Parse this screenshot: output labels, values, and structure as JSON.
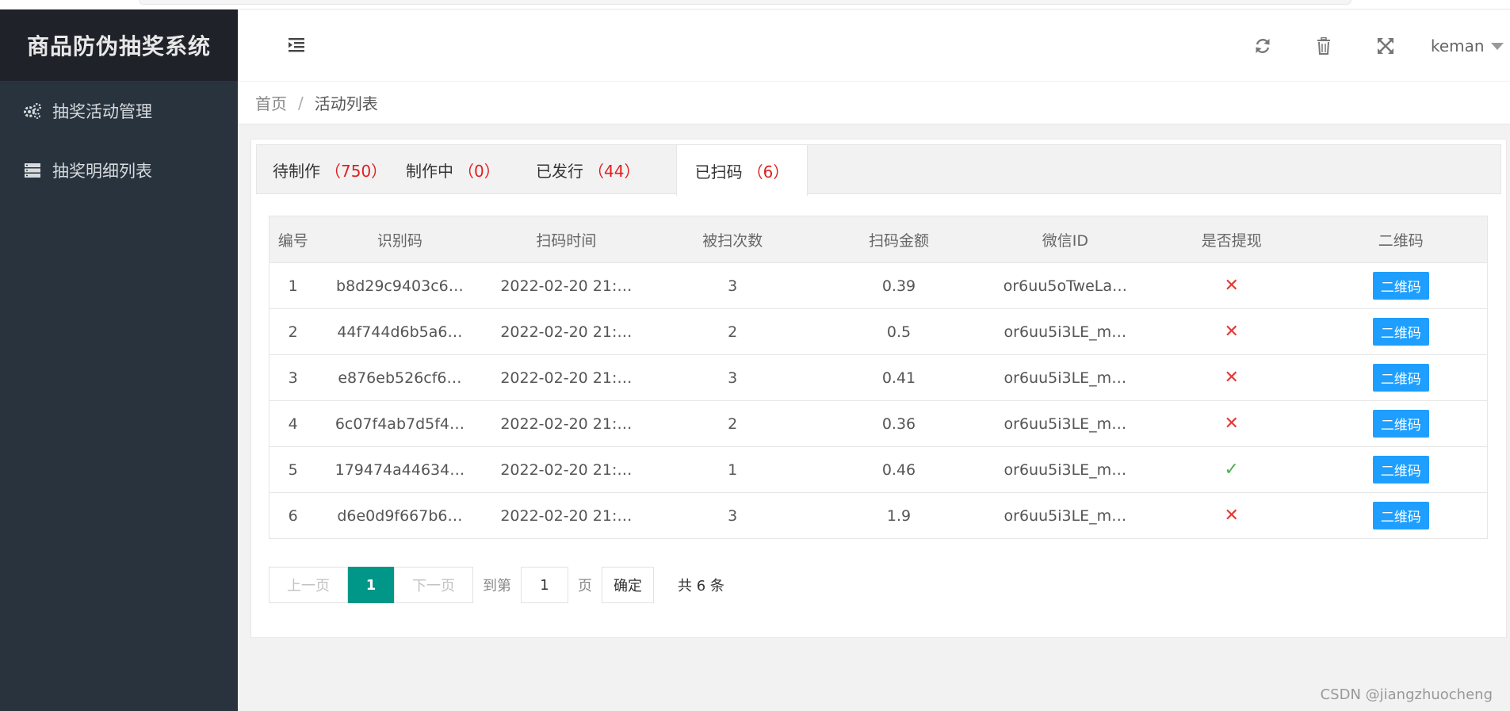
{
  "app": {
    "title": "商品防伪抽奖系统"
  },
  "sidebar": {
    "items": [
      {
        "label": "抽奖活动管理",
        "icon": "gears-icon"
      },
      {
        "label": "抽奖明细列表",
        "icon": "server-list-icon"
      }
    ]
  },
  "header": {
    "username": "keman"
  },
  "breadcrumb": {
    "home": "首页",
    "separator": "/",
    "current": "活动列表"
  },
  "tabs": [
    {
      "label": "待制作",
      "count": "（750）"
    },
    {
      "label": "制作中",
      "count": "（0）"
    },
    {
      "label": "已发行",
      "count": "（44）"
    },
    {
      "label": "已扫码",
      "count": "（6）"
    }
  ],
  "table": {
    "columns": [
      "编号",
      "识别码",
      "扫码时间",
      "被扫次数",
      "扫码金额",
      "微信ID",
      "是否提现",
      "二维码"
    ],
    "rows": [
      {
        "id": "1",
        "code": "b8d29c9403c6…",
        "time": "2022-02-20 21:…",
        "scans": "3",
        "amount": "0.39",
        "wechat": "or6uu5oTweLa…",
        "withdrawn": "✕",
        "qr": "二维码"
      },
      {
        "id": "2",
        "code": "44f744d6b5a6…",
        "time": "2022-02-20 21:…",
        "scans": "2",
        "amount": "0.5",
        "wechat": "or6uu5i3LE_m…",
        "withdrawn": "✕",
        "qr": "二维码"
      },
      {
        "id": "3",
        "code": "e876eb526cf6…",
        "time": "2022-02-20 21:…",
        "scans": "3",
        "amount": "0.41",
        "wechat": "or6uu5i3LE_m…",
        "withdrawn": "✕",
        "qr": "二维码"
      },
      {
        "id": "4",
        "code": "6c07f4ab7d5f4…",
        "time": "2022-02-20 21:…",
        "scans": "2",
        "amount": "0.36",
        "wechat": "or6uu5i3LE_m…",
        "withdrawn": "✕",
        "qr": "二维码"
      },
      {
        "id": "5",
        "code": "179474a44634…",
        "time": "2022-02-20 21:…",
        "scans": "1",
        "amount": "0.46",
        "wechat": "or6uu5i3LE_m…",
        "withdrawn": "✓",
        "qr": "二维码"
      },
      {
        "id": "6",
        "code": "d6e0d9f667b6…",
        "time": "2022-02-20 21:…",
        "scans": "3",
        "amount": "1.9",
        "wechat": "or6uu5i3LE_m…",
        "withdrawn": "✕",
        "qr": "二维码"
      }
    ]
  },
  "pager": {
    "prev": "上一页",
    "current": "1",
    "next": "下一页",
    "goto_label": "到第",
    "page_value": "1",
    "page_unit": "页",
    "confirm": "确定",
    "total": "共 6 条"
  },
  "watermark": "CSDN @jiangzhuocheng",
  "colors": {
    "sidebar": "#28333e",
    "logo_bg": "#20222a",
    "accent": "#009688",
    "button": "#1e9fff",
    "count": "#e02020"
  }
}
